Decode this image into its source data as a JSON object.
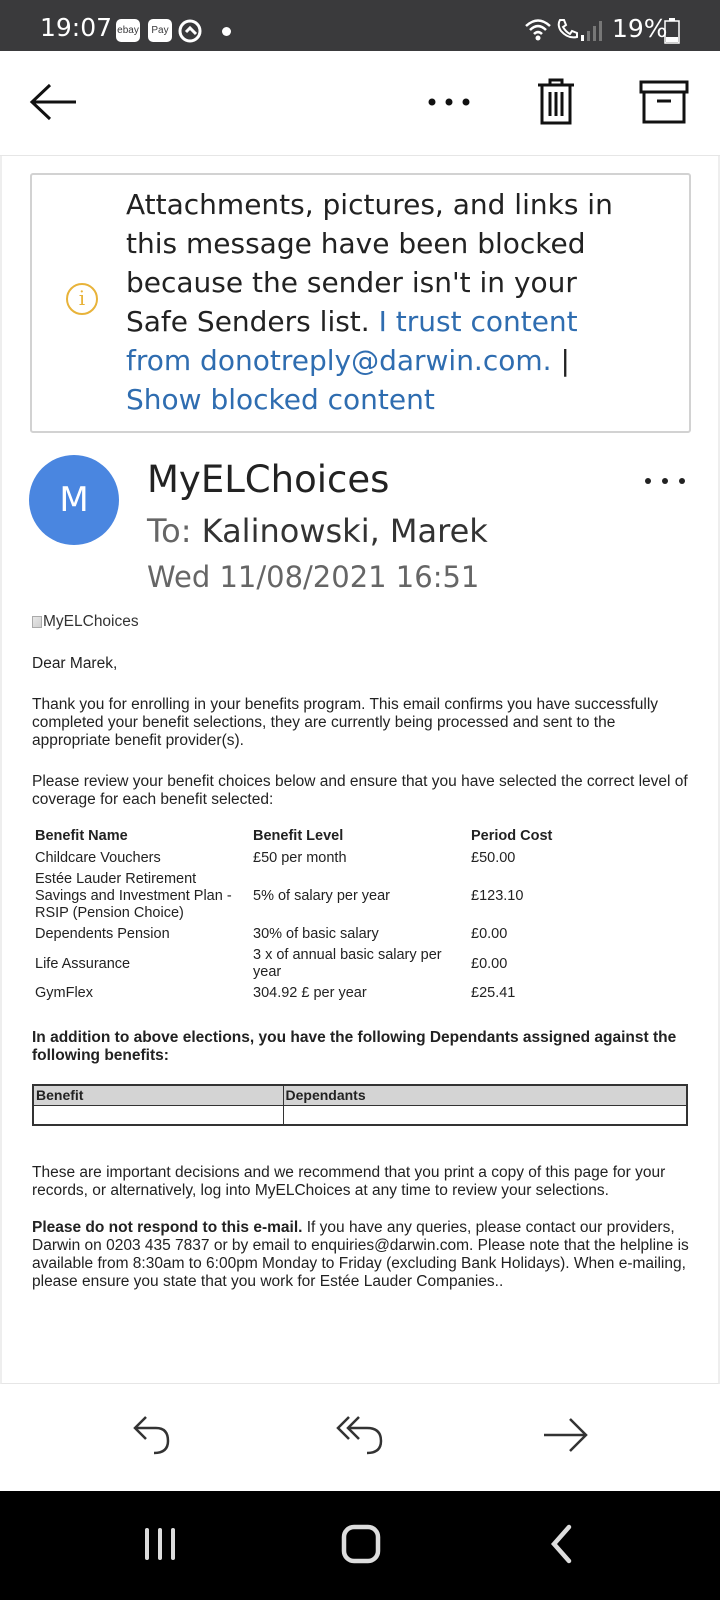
{
  "status_bar": {
    "time": "19:07",
    "notif_icons": [
      "ebay",
      "Pay"
    ],
    "battery": "19%"
  },
  "toolbar": {
    "back_icon": "arrow-left-icon",
    "more_icon": "more-horizontal-icon",
    "delete_icon": "trash-icon",
    "archive_icon": "archive-icon"
  },
  "banner": {
    "text": "Attachments, pictures, and links in this message have been blocked because the sender isn't in your Safe Senders list.",
    "trust_link": "I trust content from donotreply@darwin.com.",
    "separator": "|",
    "show_link": "Show blocked content"
  },
  "email": {
    "avatar_initial": "M",
    "sender": "MyELChoices",
    "to_label": "To:",
    "recipient": "Kalinowski, Marek",
    "date": "Wed 11/08/2021 16:51",
    "logo_alt": "MyELChoices",
    "greeting": "Dear Marek,",
    "para1": "Thank you for enrolling in your benefits program. This email confirms you have successfully completed your benefit selections, they are currently being processed and sent to the appropriate benefit provider(s).",
    "para2": "Please review your benefit choices below and ensure that you have selected the correct level of coverage for each benefit selected:",
    "benefits_table": {
      "headers": [
        "Benefit Name",
        "Benefit Level",
        "Period Cost"
      ],
      "rows": [
        [
          "Childcare Vouchers",
          "£50 per month",
          "£50.00"
        ],
        [
          "Estée Lauder Retirement Savings and Investment Plan - RSIP (Pension Choice)",
          "5% of salary per year",
          "£123.10"
        ],
        [
          "Dependents Pension",
          "30% of basic salary",
          "£0.00"
        ],
        [
          "Life Assurance",
          "3 x of annual basic salary per year",
          "£0.00"
        ],
        [
          "GymFlex",
          "304.92 £ per year",
          "£25.41"
        ]
      ]
    },
    "addition_text": "In addition to above elections, you have the following Dependants assigned against the following benefits:",
    "deps_table": {
      "headers": [
        "Benefit",
        "Dependants"
      ]
    },
    "para_important": "These are important decisions and we recommend that you print a copy of this page for your records, or alternatively, log into MyELChoices at any time to review your selections.",
    "donot_bold": "Please do not respond to this e-mail.",
    "donot_rest": " If you have any queries, please contact our providers, Darwin on 0203 435 7837 or by email to enquiries@darwin.com. Please note that the helpline is available from 8:30am to 6:00pm Monday to Friday (excluding Bank Holidays). When e-mailing, please ensure you state that you work for Estée Lauder Companies.."
  },
  "actions": {
    "reply_icon": "reply-icon",
    "reply_all_icon": "reply-all-icon",
    "forward_icon": "forward-icon"
  },
  "navigation": {
    "recents_icon": "recent-apps-icon",
    "home_icon": "home-icon",
    "back_icon": "back-chevron-icon"
  }
}
